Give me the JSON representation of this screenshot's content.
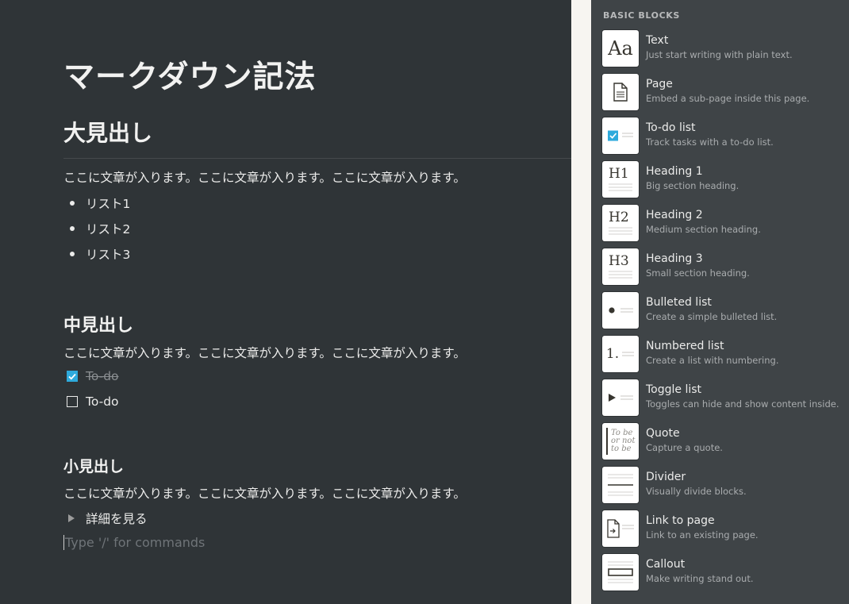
{
  "editor": {
    "title": "マークダウン記法",
    "heading1": "大見出し",
    "para1": "ここに文章が入ります。ここに文章が入ります。ここに文章が入ります。",
    "bullets": [
      "リスト1",
      "リスト2",
      "リスト3"
    ],
    "heading2": "中見出し",
    "para2": "ここに文章が入ります。ここに文章が入ります。ここに文章が入ります。",
    "todos": [
      {
        "label": "To-do",
        "checked": true
      },
      {
        "label": "To-do",
        "checked": false
      }
    ],
    "heading3": "小見出し",
    "para3": "ここに文章が入ります。ここに文章が入ります。ここに文章が入ります。",
    "toggle_label": "詳細を見る",
    "placeholder": "Type '/' for commands"
  },
  "menu": {
    "section_label": "BASIC BLOCKS",
    "items": [
      {
        "icon": "text-icon",
        "title": "Text",
        "desc": "Just start writing with plain text."
      },
      {
        "icon": "page-icon",
        "title": "Page",
        "desc": "Embed a sub-page inside this page."
      },
      {
        "icon": "todo-list-icon",
        "title": "To-do list",
        "desc": "Track tasks with a to-do list."
      },
      {
        "icon": "heading-1-icon",
        "title": "Heading 1",
        "desc": "Big section heading."
      },
      {
        "icon": "heading-2-icon",
        "title": "Heading 2",
        "desc": "Medium section heading."
      },
      {
        "icon": "heading-3-icon",
        "title": "Heading 3",
        "desc": "Small section heading."
      },
      {
        "icon": "bulleted-list-icon",
        "title": "Bulleted list",
        "desc": "Create a simple bulleted list."
      },
      {
        "icon": "numbered-list-icon",
        "title": "Numbered list",
        "desc": "Create a list with numbering."
      },
      {
        "icon": "toggle-list-icon",
        "title": "Toggle list",
        "desc": "Toggles can hide and show content inside."
      },
      {
        "icon": "quote-icon",
        "title": "Quote",
        "desc": "Capture a quote."
      },
      {
        "icon": "divider-icon",
        "title": "Divider",
        "desc": "Visually divide blocks."
      },
      {
        "icon": "link-to-page-icon",
        "title": "Link to page",
        "desc": "Link to an existing page."
      },
      {
        "icon": "callout-icon",
        "title": "Callout",
        "desc": "Make writing stand out."
      }
    ],
    "thumb_text": {
      "text": "Aa",
      "h1": "H1",
      "h2": "H2",
      "h3": "H3",
      "num": "1.",
      "quote": "To be or not to be"
    }
  },
  "colors": {
    "editor_bg": "#2f3437",
    "menu_bg": "#3f4447",
    "checkbox_accent": "#2eaadc"
  }
}
